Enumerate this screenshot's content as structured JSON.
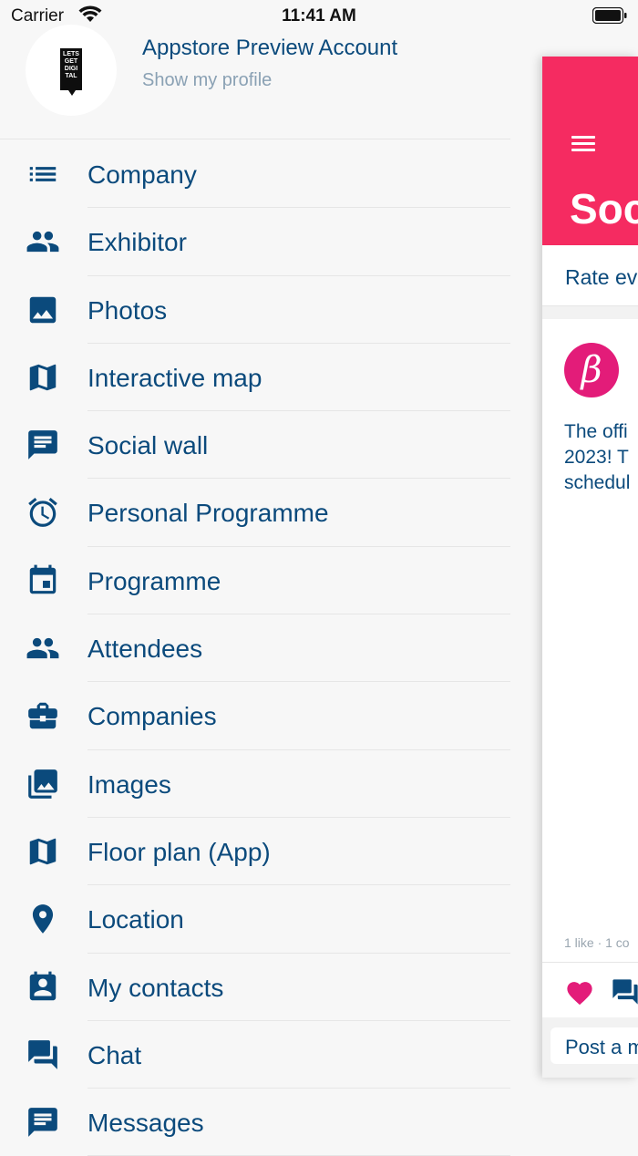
{
  "status_bar": {
    "carrier": "Carrier",
    "time": "11:41 AM"
  },
  "account": {
    "name": "Appstore Preview Account",
    "subtitle": "Show my profile",
    "logo_text": "LETS GET DIGI TAL"
  },
  "menu": [
    {
      "label": "Company",
      "icon": "list-icon"
    },
    {
      "label": "Exhibitor",
      "icon": "people-icon"
    },
    {
      "label": "Photos",
      "icon": "image-icon"
    },
    {
      "label": "Interactive map",
      "icon": "map-icon"
    },
    {
      "label": "Social wall",
      "icon": "message-icon"
    },
    {
      "label": "Personal Programme",
      "icon": "alarm-icon"
    },
    {
      "label": "Programme",
      "icon": "calendar-icon"
    },
    {
      "label": "Attendees",
      "icon": "people-icon"
    },
    {
      "label": "Companies",
      "icon": "briefcase-icon"
    },
    {
      "label": "Images",
      "icon": "photo-library-icon"
    },
    {
      "label": "Floor plan (App)",
      "icon": "map-icon"
    },
    {
      "label": "Location",
      "icon": "location-pin-icon"
    },
    {
      "label": "My contacts",
      "icon": "contact-card-icon"
    },
    {
      "label": "Chat",
      "icon": "chat-icon"
    },
    {
      "label": "Messages",
      "icon": "messages-icon"
    }
  ],
  "panel": {
    "title": "Soc",
    "rate": "Rate ev",
    "avatar_letter": "β",
    "post_lines": [
      "The offi",
      "2023! T",
      "schedul"
    ],
    "likes": "1 like · 1 co",
    "post_placeholder": "Post a m"
  },
  "colors": {
    "accent": "#f52b61",
    "text": "#0b4a7c",
    "heart": "#e31c79"
  }
}
